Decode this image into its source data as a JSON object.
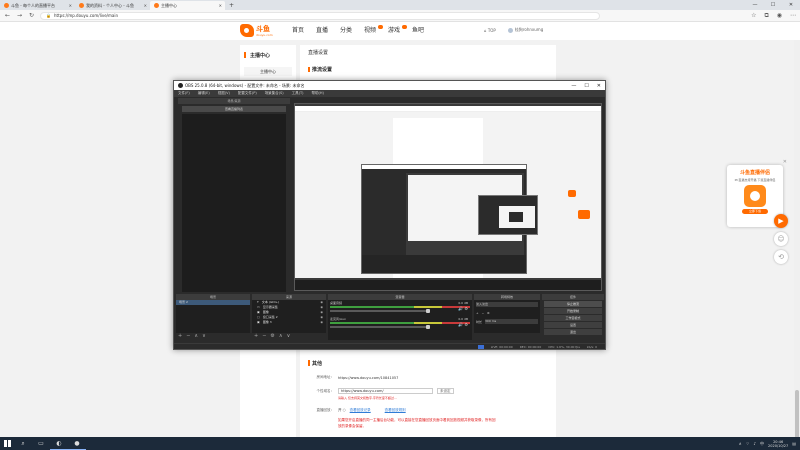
{
  "browser": {
    "tabs": [
      {
        "label": "斗鱼 - 每个人的直播平台",
        "active": false
      },
      {
        "label": "我的资料 - 个人中心 - 斗鱼",
        "active": false
      },
      {
        "label": "主播中心",
        "active": true
      }
    ],
    "url": "https://mp.douyu.com/live/main"
  },
  "site": {
    "logo_cn": "斗鱼",
    "logo_en": "douyu.com",
    "nav": [
      "首页",
      "直播",
      "分类",
      "视频",
      "游戏",
      "鱼吧"
    ],
    "user_name": "桂狗rohnxumg",
    "top_label": "TOP"
  },
  "sidebar": {
    "title": "主播中心",
    "item": "主播中心"
  },
  "main": {
    "title": "直播设置",
    "subtitle": "推流设置"
  },
  "lower": {
    "title": "其他",
    "room_label": "房间地址：",
    "room_url": "https://www.douyu.com/10841057",
    "custom_label": "个性域名：",
    "custom_value": "https://www.douyu.com/",
    "custom_select": "未设定",
    "hint": "请输入 仅支持英文和数字,字符长度不超过...",
    "record_label": "直播回放：",
    "record_value": "开 ○",
    "link_a": "查看回放记录",
    "link_b": "查看回放规则",
    "warning": "如果您开启直播的同一主播后台功能，可以直接在您直播回放页面中看到回放视频并获取录像，所有回放的录像会保留。"
  },
  "promo": {
    "title": "斗鱼直播伴侣",
    "sub": "PC直播支持开播 下载直播伴侣",
    "btn": "立即下载"
  },
  "obs": {
    "title": "OBS 25.0.8 (64-bit, windows) - 配置文件: 未命名 - 场景: 未命名",
    "menu": [
      "文件(F)",
      "编辑(E)",
      "视图(V)",
      "配置文件(P)",
      "场景集合(S)",
      "工具(T)",
      "帮助(H)"
    ],
    "left_head": "场景/来源",
    "left_btn": "查看直播列表",
    "docks": {
      "scenes": "场景",
      "sources": "来源",
      "mixer": "混音器",
      "transitions": "转场特效",
      "controls": "控件"
    },
    "scene_item": "场景 2",
    "sources": [
      "文本 (GDI+)",
      "显示器采集",
      "图像",
      "窗口采集 2",
      "图像 3"
    ],
    "mixer": [
      {
        "name": "桌面音频",
        "db": "0.0 dB"
      },
      {
        "name": "麦克风/Aux",
        "db": "0.0 dB"
      }
    ],
    "transition_name": "淡入淡出",
    "transition_duration_label": "时长",
    "transition_duration": "300 ms",
    "controls": [
      "停止推流",
      "开始录制",
      "工作室模式",
      "设置",
      "退出"
    ],
    "status": [
      "LIVE: 00:00:00",
      "REC: 00:00:00",
      "CPU: 1.6%, 30.00 fps",
      "kb/s: 0"
    ]
  },
  "taskbar": {
    "time": "20:46",
    "date": "2020/10/27"
  }
}
